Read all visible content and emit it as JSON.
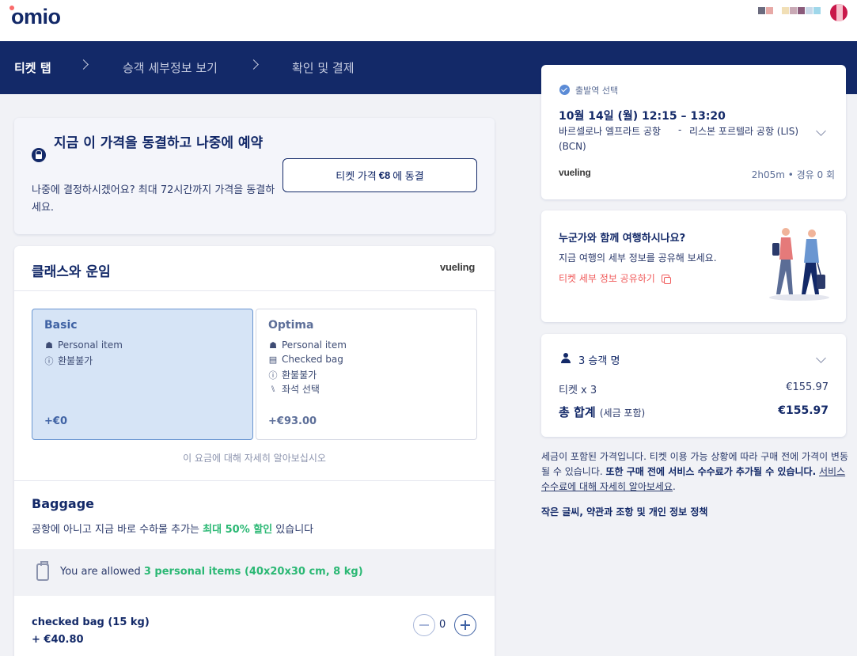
{
  "brand": {
    "logo": "omio",
    "swatches": [
      "#6b6b7e",
      "#e7a9a6",
      "#ffffff",
      "#f1dfb6",
      "#c9a9b5",
      "#8a5a7a",
      "#c9d9e9",
      "#9fd7ea"
    ]
  },
  "steps": [
    {
      "label": "티켓 탭",
      "active": true
    },
    {
      "label": "승객 세부정보 보기",
      "active": false
    },
    {
      "label": "확인 및 결제",
      "active": false
    }
  ],
  "freeze": {
    "title": "지금 이 가격을 동결하고 나중에 예약",
    "subtitle": "나중에 결정하시겠어요? 최대 72시간까지 가격을 동결하세요.",
    "button_prefix": "티켓 가격 ",
    "button_amount": "€8",
    "button_suffix": "에 동결"
  },
  "fare": {
    "title": "클래스와 운임",
    "airline_logo": "vueling",
    "options": [
      {
        "name": "Basic",
        "selected": true,
        "features": [
          {
            "icon": "bag-icon",
            "glyph": "☗",
            "label": "Personal item"
          },
          {
            "icon": "no-refund-icon",
            "glyph": "ⓘ",
            "label": "환불불가"
          }
        ],
        "price": "+€0"
      },
      {
        "name": "Optima",
        "selected": false,
        "features": [
          {
            "icon": "bag-icon",
            "glyph": "☗",
            "label": "Personal item"
          },
          {
            "icon": "suitcase-icon",
            "glyph": "▤",
            "label": "Checked bag"
          },
          {
            "icon": "no-refund-icon",
            "glyph": "ⓘ",
            "label": "환불불가"
          },
          {
            "icon": "seat-icon",
            "glyph": "⑊",
            "label": "좌석 선택"
          }
        ],
        "price": "+€93.00"
      }
    ],
    "learn_more": "이 요금에 대해 자세히 알아보십시오"
  },
  "baggage": {
    "title": "Baggage",
    "subtitle_prefix": "공항에 아니고 지금 바로 수하물 추가는 ",
    "subtitle_highlight": "최대 50% 할인",
    "subtitle_suffix": " 있습니다",
    "allowed_prefix": "You are allowed ",
    "allowed_highlight": "3 personal items (40x20x30 cm, 8 kg)",
    "checked_name": "checked bag (15 kg)",
    "checked_price": "+ €40.80",
    "quantity": "0"
  },
  "trip": {
    "label": "출발역 선택",
    "date_time": "10월 14일 (월)   12:15 – 13:20",
    "from": "바르셀로나 엘프라트 공항 (BCN)",
    "dash": "-",
    "to": "리스본 포르텔라 공항 (LIS)",
    "airline_logo": "vueling",
    "meta": "2h05m • 경유 0 회"
  },
  "share": {
    "title": "누군가와 함께 여행하시나요?",
    "subtitle": "지금 여행의 세부 정보를 공유해 보세요.",
    "link": "티켓 세부 정보 공유하기"
  },
  "price": {
    "passengers": "3 승객 명",
    "ticket_label": "티켓 x 3",
    "ticket_value": "€155.97",
    "total_label": "총 합계",
    "total_note": "(세금 포함)",
    "total_value": "€155.97"
  },
  "note": {
    "part1": "세금이 포함된 가격입니다. 티켓 이용 가능 상황에 따라 구매 전에 가격이 변동될 수 있습니다. ",
    "bold": "또한 구매 전에 서비스 수수료가 추가될 수 있습니다.",
    "space": " ",
    "link": "서비스 수수료에 대해 자세히 알아보세요",
    "end": "."
  },
  "legal": "작은 글씨, 약관과 조항 및 개인 정보 정책"
}
